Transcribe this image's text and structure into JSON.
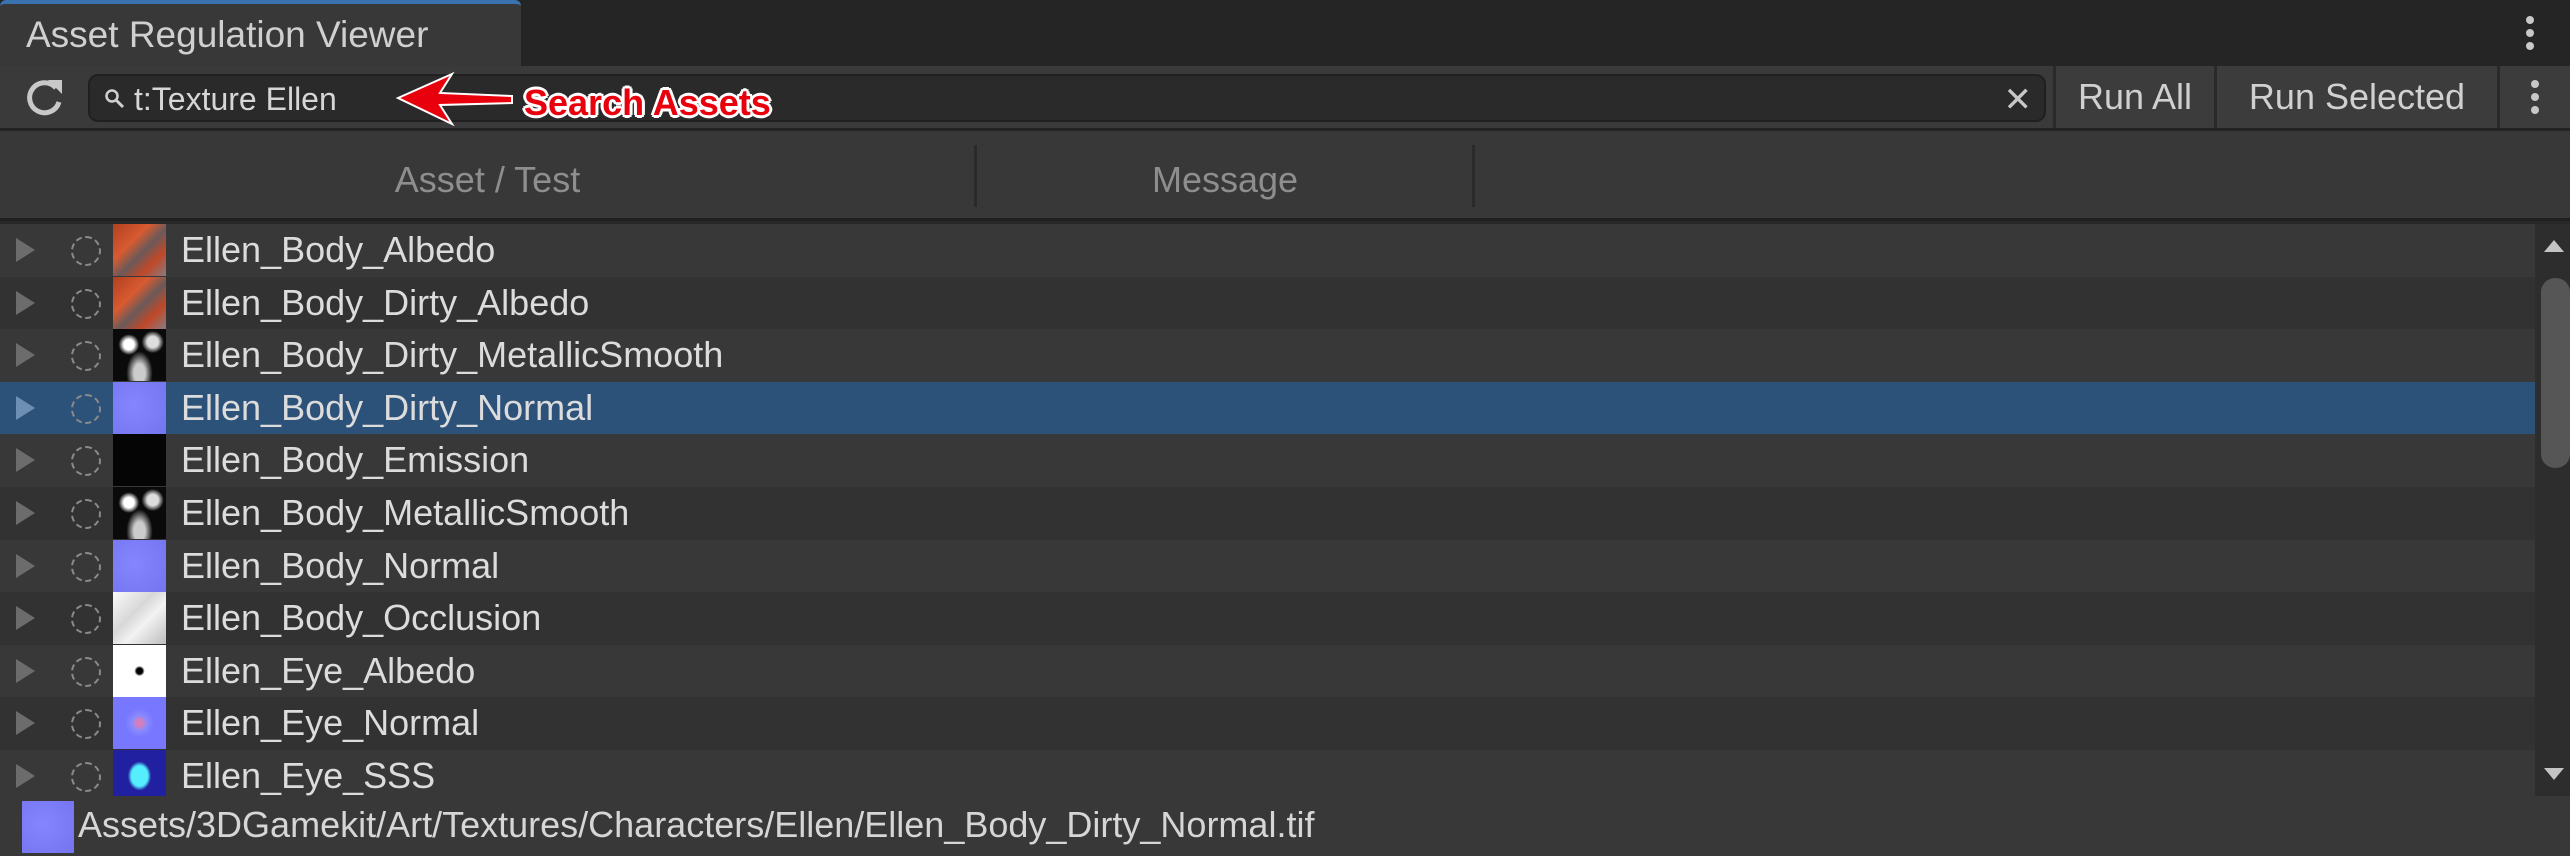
{
  "window": {
    "tab_title": "Asset Regulation Viewer"
  },
  "toolbar": {
    "search_value": "t:Texture Ellen",
    "run_all_label": "Run All",
    "run_selected_label": "Run Selected"
  },
  "annotation": {
    "label": "Search Assets",
    "color": "#e8000d"
  },
  "columns": [
    "Asset / Test",
    "Message"
  ],
  "rows": [
    {
      "name": "Ellen_Body_Albedo",
      "thumb": "albedo"
    },
    {
      "name": "Ellen_Body_Dirty_Albedo",
      "thumb": "albedo"
    },
    {
      "name": "Ellen_Body_Dirty_MetallicSmooth",
      "thumb": "metallic"
    },
    {
      "name": "Ellen_Body_Dirty_Normal",
      "thumb": "normal",
      "selected": true
    },
    {
      "name": "Ellen_Body_Emission",
      "thumb": "emission"
    },
    {
      "name": "Ellen_Body_MetallicSmooth",
      "thumb": "metallic"
    },
    {
      "name": "Ellen_Body_Normal",
      "thumb": "normal"
    },
    {
      "name": "Ellen_Body_Occlusion",
      "thumb": "occlusion"
    },
    {
      "name": "Ellen_Eye_Albedo",
      "thumb": "eye-albedo"
    },
    {
      "name": "Ellen_Eye_Normal",
      "thumb": "eye-normal"
    },
    {
      "name": "Ellen_Eye_SSS",
      "thumb": "eye-sss"
    }
  ],
  "footer": {
    "selected_path": "Assets/3DGamekit/Art/Textures/Characters/Ellen/Ellen_Body_Dirty_Normal.tif"
  },
  "colors": {
    "selection": "#2d5279",
    "tab_accent": "#3a72b0"
  }
}
